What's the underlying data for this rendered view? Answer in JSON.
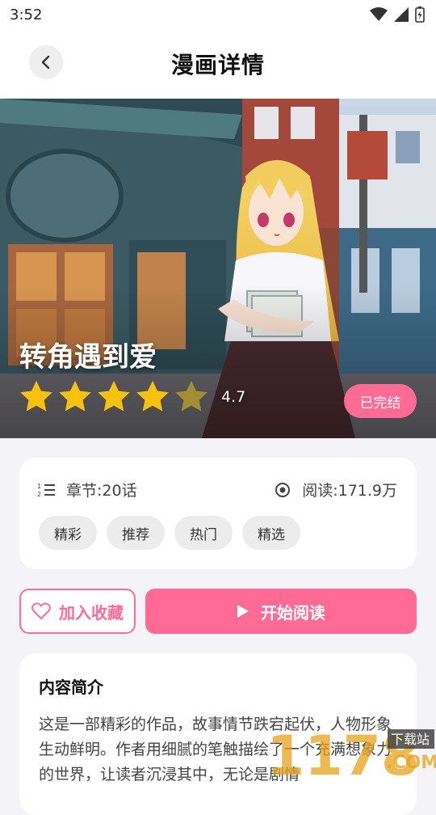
{
  "status_bar": {
    "time": "3:52"
  },
  "header": {
    "title": "漫画详情"
  },
  "hero": {
    "title": "转角遇到爱",
    "rating": 4.7,
    "rating_text": "4.7",
    "status_badge": "已完结"
  },
  "info": {
    "chapters": "章节:20话",
    "reads": "阅读:171.9万",
    "tags": [
      "精彩",
      "推荐",
      "热门",
      "精选"
    ]
  },
  "actions": {
    "favorite": "加入收藏",
    "start_reading": "开始阅读"
  },
  "description": {
    "title": "内容简介",
    "text": "这是一部精彩的作品，故事情节跌宕起伏，人物形象生动鲜明。作者用细腻的笔触描绘了一个充满想象力的世界，让读者沉浸其中，无论是剧情"
  },
  "watermark": {
    "text": "1178",
    "suffix": ".COM",
    "badge": "下载站"
  },
  "colors": {
    "accent": "#ff6b96",
    "star": "#f6c20f"
  }
}
